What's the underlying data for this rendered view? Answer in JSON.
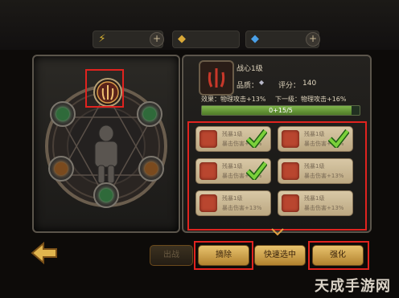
{
  "header": {
    "resources": [
      {
        "icon": "lightning-icon",
        "value": ""
      },
      {
        "icon": "gold-icon",
        "value": ""
      },
      {
        "icon": "gem-icon",
        "value": ""
      }
    ]
  },
  "skill": {
    "name": "战心1级",
    "quality_label": "品质：",
    "score_label": "评分：",
    "score": "140",
    "effect_label": "效果：",
    "effect_value": "物理攻击+13%",
    "next_label": "下一级：",
    "next_value": "物理攻击+16%",
    "progress_text": "0+15/5",
    "progress": 0.95
  },
  "cards": [
    {
      "title": "残暴1级",
      "desc": "暴击伤害+13%",
      "checked": true
    },
    {
      "title": "残暴1级",
      "desc": "暴击伤害+13%",
      "checked": true
    },
    {
      "title": "残暴1级",
      "desc": "暴击伤害+13%",
      "checked": true
    },
    {
      "title": "残暴1级",
      "desc": "暴击伤害+13%",
      "checked": false
    },
    {
      "title": "残暴1级",
      "desc": "暴击伤害+13%",
      "checked": false
    },
    {
      "title": "残暴1级",
      "desc": "暴击伤害+13%",
      "checked": false
    }
  ],
  "buttons": {
    "dim": "出战",
    "remove": "摘除",
    "quick_select": "快速选中",
    "enhance": "强化"
  },
  "watermark": "天成手游网",
  "colors": {
    "highlight": "#e0231f",
    "gold": "#e8c36e",
    "progress": "#7fb54b"
  }
}
